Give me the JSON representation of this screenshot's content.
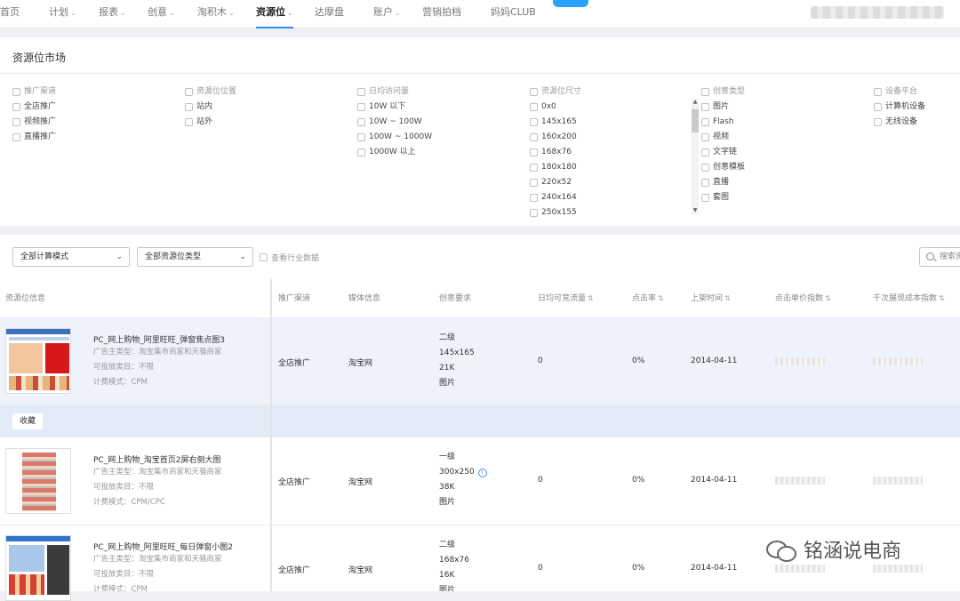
{
  "topnav": {
    "items": [
      {
        "label": "首页",
        "chev": ""
      },
      {
        "label": "计划",
        "chev": "⌄"
      },
      {
        "label": "报表",
        "chev": "⌄"
      },
      {
        "label": "创意",
        "chev": "⌄"
      },
      {
        "label": "淘积木",
        "chev": "⌄"
      },
      {
        "label": "资源位",
        "chev": "⌄"
      },
      {
        "label": "达摩盘",
        "chev": ""
      },
      {
        "label": "账户",
        "chev": "⌄"
      },
      {
        "label": "营销拍档",
        "chev": ""
      },
      {
        "label": "妈妈CLUB",
        "chev": ""
      }
    ],
    "active_index": 5
  },
  "market": {
    "title": "资源位市场",
    "columns": [
      {
        "header": "推广渠道",
        "options": [
          "全店推广",
          "视频推广",
          "直播推广"
        ]
      },
      {
        "header": "资源位位置",
        "options": [
          "站内",
          "站外"
        ]
      },
      {
        "header": "日均访问量",
        "options": [
          "10W 以下",
          "10W ~ 100W",
          "100W ~ 1000W",
          "1000W 以上"
        ]
      },
      {
        "header": "资源位尺寸",
        "options": [
          "0x0",
          "145x165",
          "160x200",
          "168x76",
          "180x180",
          "220x52",
          "240x164",
          "250x155"
        ]
      },
      {
        "header": "创意类型",
        "options": [
          "图片",
          "Flash",
          "视频",
          "文字链",
          "创意模板",
          "直播",
          "套图"
        ]
      },
      {
        "header": "设备平台",
        "options": [
          "计算机设备",
          "无线设备"
        ]
      }
    ]
  },
  "toolbar": {
    "calc_mode": "全部计算模式",
    "slot_type": "全部资源位类型",
    "industry_data": "查看行业数据",
    "search_placeholder": "搜索资"
  },
  "table": {
    "headers": {
      "info": "资源位信息",
      "channel": "推广渠道",
      "media": "媒体信息",
      "creative": "创意要求",
      "traffic": "日均可竞流量",
      "ctr": "点击率",
      "online": "上架时间",
      "cpc_index": "点击单价指数",
      "cpm_index": "千次展现成本指数"
    },
    "sort_glyph": "⇅",
    "favorite_label": "收藏",
    "rows": [
      {
        "name": "PC_网上购物_阿里旺旺_弹窗焦点图3",
        "advertiser": "广告主类型：淘宝集市商家和天猫商家",
        "category": "可投放类目：不限",
        "billing": "计费模式：CPM",
        "channel": "全店推广",
        "media": "淘宝网",
        "level": "二级",
        "size": "145x165",
        "filesize": "21K",
        "ctype": "图片",
        "traffic": "0",
        "ctr": "0%",
        "date": "2014-04-11"
      },
      {
        "name": "PC_网上购物_淘宝首页2屏右侧大图",
        "advertiser": "广告主类型：淘宝集市商家和天猫商家",
        "category": "可投放类目：不限",
        "billing": "计费模式：CPM/CPC",
        "channel": "全店推广",
        "media": "淘宝网",
        "level": "一级",
        "size": "300x250",
        "filesize": "38K",
        "ctype": "图片",
        "traffic": "0",
        "ctr": "0%",
        "date": "2014-04-11"
      },
      {
        "name": "PC_网上购物_阿里旺旺_每日弹窗小图2",
        "advertiser": "广告主类型：淘宝集市商家和天猫商家",
        "category": "可投放类目：不限",
        "billing": "计费模式：CPM",
        "channel": "全店推广",
        "media": "淘宝网",
        "level": "二级",
        "size": "168x76",
        "filesize": "16K",
        "ctype": "图片",
        "traffic": "0",
        "ctr": "0%",
        "date": "2014-04-11"
      }
    ]
  },
  "watermark": "铭涵说电商"
}
